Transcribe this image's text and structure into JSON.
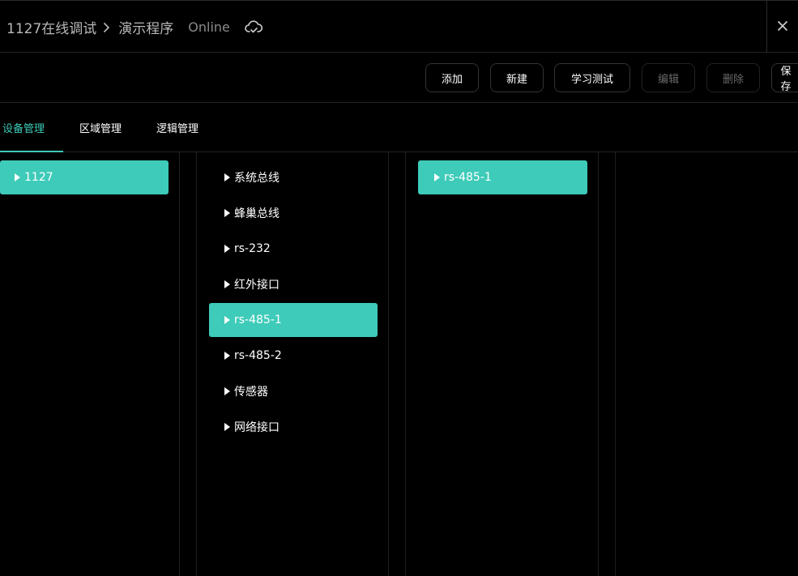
{
  "header": {
    "breadcrumb_parent": "1127在线调试",
    "breadcrumb_current": "演示程序",
    "status": "Online"
  },
  "toolbar": {
    "add_label": "添加",
    "new_label": "新建",
    "learn_test_label": "学习测试",
    "edit_label": "编辑",
    "delete_label": "删除",
    "save_label": "保存"
  },
  "tabs": [
    {
      "label": "设备管理",
      "active": true
    },
    {
      "label": "区域管理",
      "active": false
    },
    {
      "label": "逻辑管理",
      "active": false
    }
  ],
  "columns": {
    "devices": [
      {
        "label": "1127",
        "selected": true
      }
    ],
    "interfaces": [
      {
        "label": "系统总线",
        "selected": false
      },
      {
        "label": "蜂巢总线",
        "selected": false
      },
      {
        "label": "rs-232",
        "selected": false
      },
      {
        "label": "红外接口",
        "selected": false
      },
      {
        "label": "rs-485-1",
        "selected": true
      },
      {
        "label": "rs-485-2",
        "selected": false
      },
      {
        "label": "传感器",
        "selected": false
      },
      {
        "label": "网络接口",
        "selected": false
      }
    ],
    "ports": [
      {
        "label": "rs-485-1",
        "selected": true
      }
    ]
  },
  "colors": {
    "accent": "#3ecbb9",
    "background": "#000000"
  }
}
